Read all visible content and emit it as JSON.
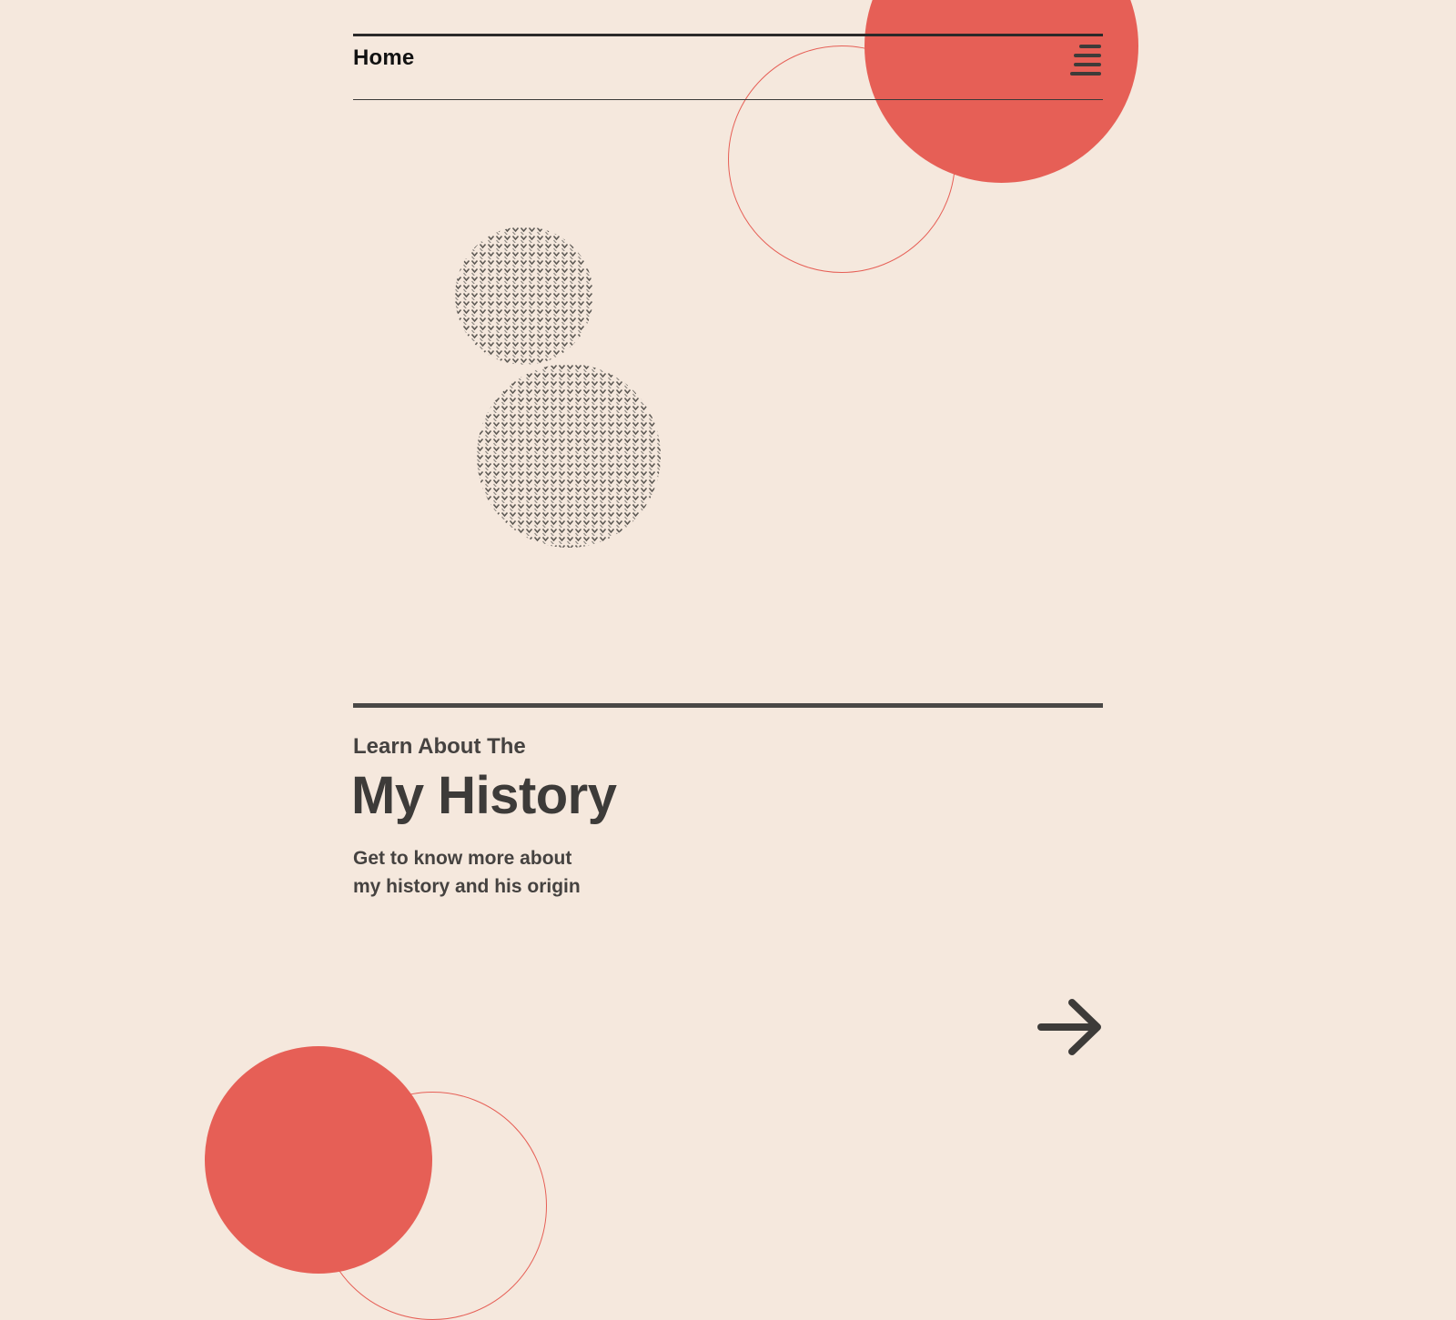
{
  "header": {
    "nav_home_label": "Home",
    "menu_icon": "hamburger-menu-icon"
  },
  "section": {
    "eyebrow": "Learn About The",
    "title": "My History",
    "description_lines": [
      "Get to know more about",
      "my history and his origin"
    ],
    "next_icon": "arrow-right-icon"
  },
  "theme": {
    "background": "#f5e8dd",
    "accent": "#e65f56",
    "text_dark": "#3d3b39",
    "pattern_ink": "#5e5a55"
  }
}
